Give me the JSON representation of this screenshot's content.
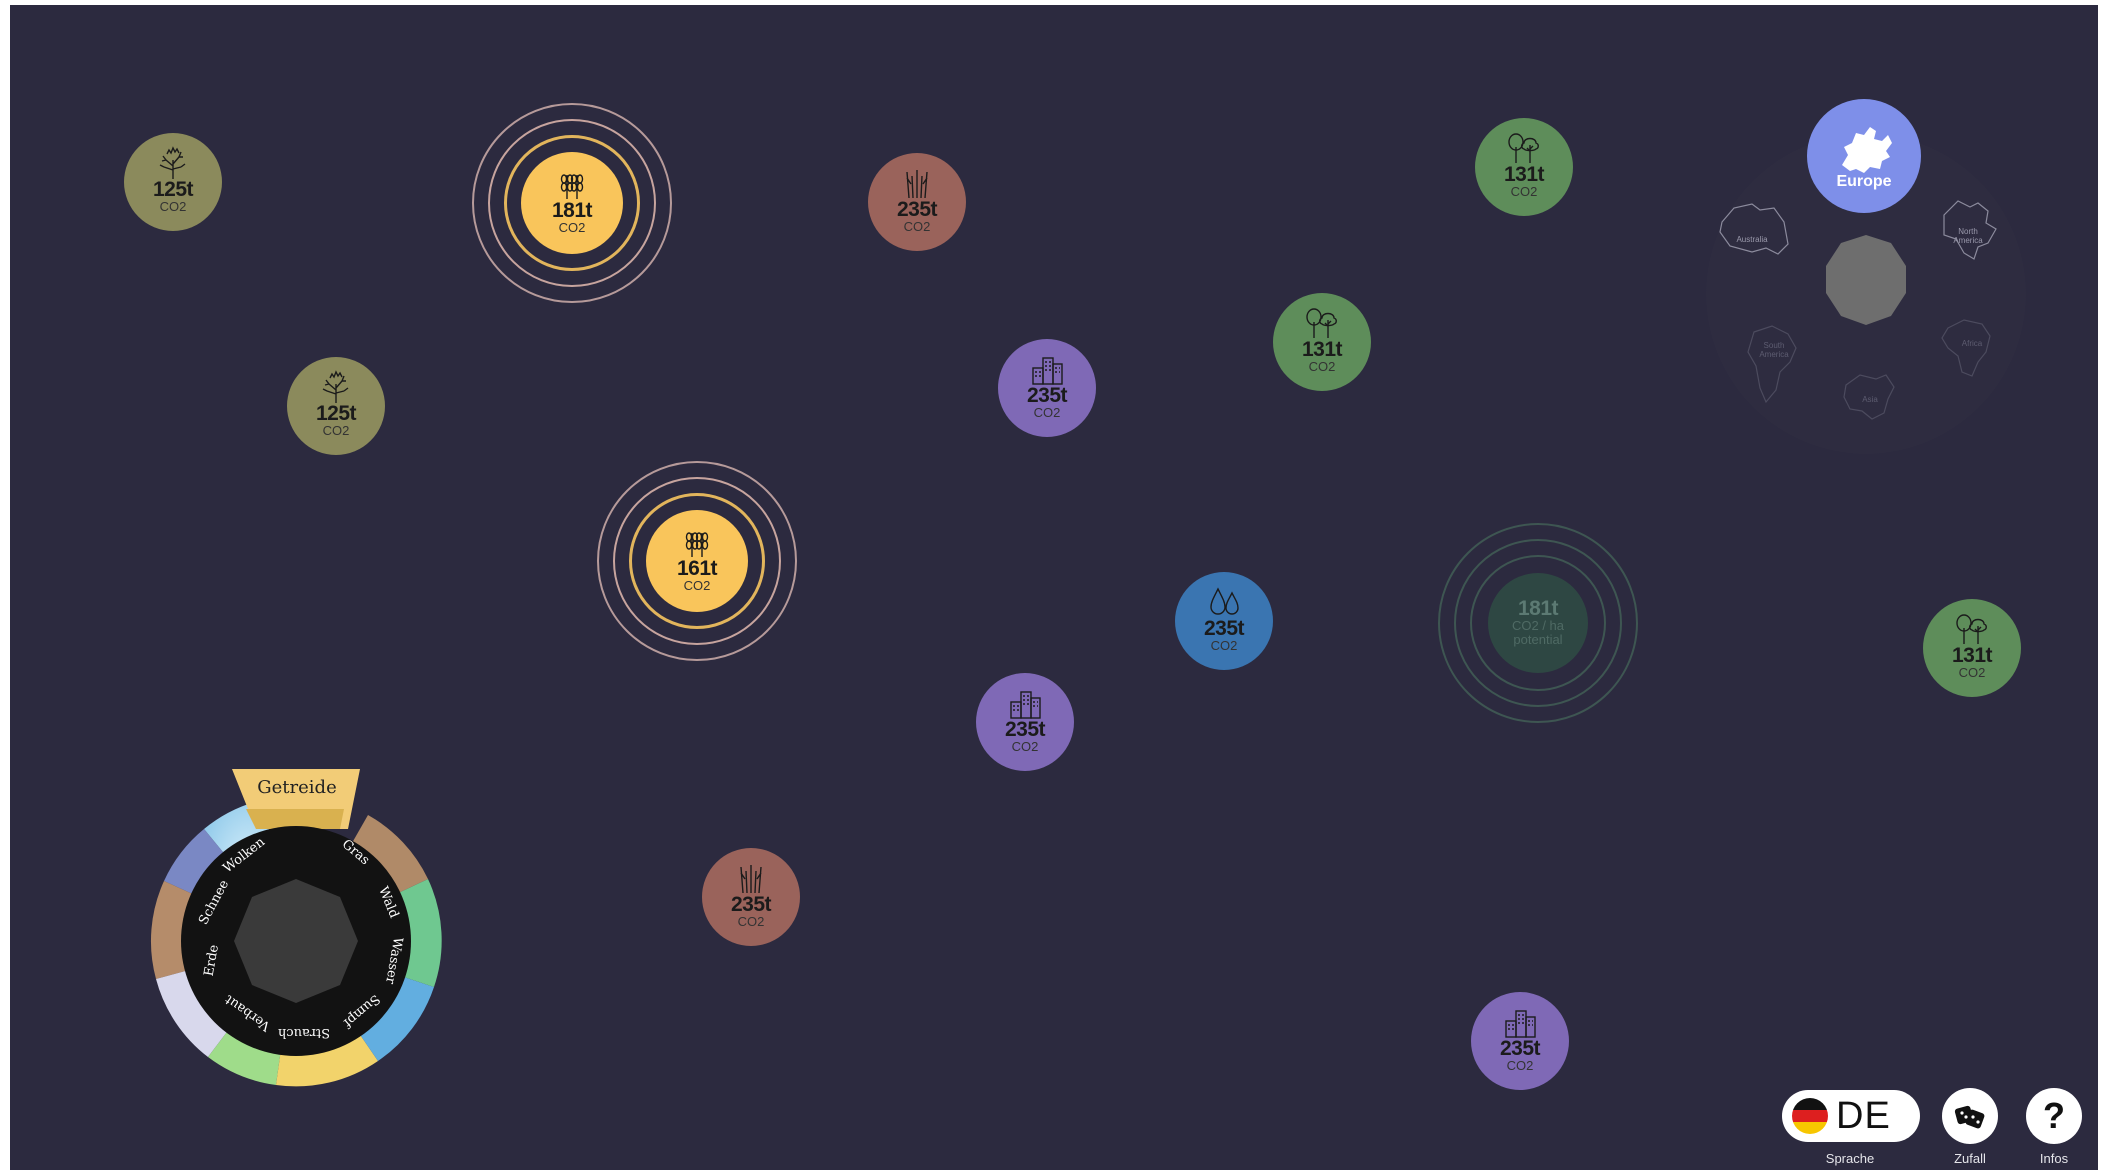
{
  "bubbles": [
    {
      "value": "125t",
      "unit": "CO2",
      "icon": "shrub-icon"
    },
    {
      "value": "125t",
      "unit": "CO2",
      "icon": "shrub-icon"
    },
    {
      "value": "181t",
      "unit": "CO2",
      "icon": "grain-icon"
    },
    {
      "value": "161t",
      "unit": "CO2",
      "icon": "grain-icon"
    },
    {
      "value": "235t",
      "unit": "CO2",
      "icon": "grass-icon"
    },
    {
      "value": "235t",
      "unit": "CO2",
      "icon": "city-icon"
    },
    {
      "value": "235t",
      "unit": "CO2",
      "icon": "city-icon"
    },
    {
      "value": "235t",
      "unit": "CO2",
      "icon": "grass-icon"
    },
    {
      "value": "235t",
      "unit": "CO2",
      "icon": "water-drops-icon"
    },
    {
      "value": "131t",
      "unit": "CO2",
      "icon": "trees-icon"
    },
    {
      "value": "131t",
      "unit": "CO2",
      "icon": "trees-icon"
    },
    {
      "value": "131t",
      "unit": "CO2",
      "icon": "trees-icon"
    },
    {
      "value": "235t",
      "unit": "CO2",
      "icon": "city-icon"
    }
  ],
  "potential": {
    "value": "181t",
    "unit": "CO2 / ha",
    "sub": "potential"
  },
  "region": {
    "selected": "Europe",
    "others": [
      "Australia",
      "North America",
      "South America",
      "Africa",
      "Asia"
    ]
  },
  "ecosystems": {
    "selected": "Getreide",
    "labels": [
      "Wolken",
      "Gras",
      "Wald",
      "Wasser",
      "Sumpf",
      "Strauch",
      "Verbaut",
      "Erde",
      "Schnee"
    ]
  },
  "controls": {
    "language_code": "DE",
    "language_label": "Sprache",
    "random_label": "Zufall",
    "info_label": "Infos",
    "info_glyph": "?"
  },
  "colors": {
    "background": "#2c2a3f",
    "olive": "#8b8a5c",
    "brown": "#9a635b",
    "purple": "#7f69b6",
    "green": "#5e8d5a",
    "blue": "#3a75b1",
    "yellow": "#f9c55b",
    "europe": "#7e8fe9"
  }
}
